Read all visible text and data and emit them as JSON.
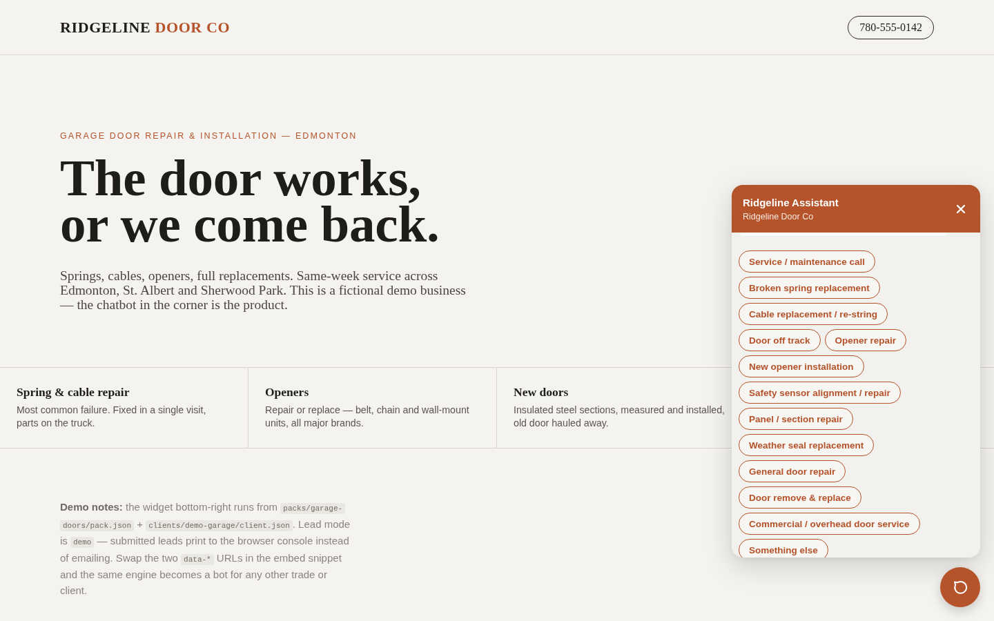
{
  "header": {
    "brand": {
      "name": "RIDGELINE",
      "accent": "DOOR CO"
    },
    "phone": "780-555-0142"
  },
  "hero": {
    "eyebrow": "GARAGE DOOR REPAIR & INSTALLATION — EDMONTON",
    "headline": [
      "The door works,",
      "or we come back."
    ],
    "lede": "Springs, cables, openers, full replacements. Same-week service across Edmonton, St. Albert and Sherwood Park. This is a fictional demo business — the chatbot in the corner is the product."
  },
  "services": [
    {
      "title": "Spring & cable repair",
      "description": "Most common failure. Fixed in a single visit, parts on the truck."
    },
    {
      "title": "Openers",
      "description": "Repair or replace — belt, chain and wall-mount units, all major brands."
    },
    {
      "title": "New doors",
      "description": "Insulated steel sections, measured and installed, old door hauled away."
    }
  ],
  "demo_notes": [
    {
      "kind": "text",
      "text": "**Demo notes:** the widget bottom-right runs from "
    },
    {
      "kind": "code",
      "text": "packs/garage-doors/pack.json"
    },
    {
      "kind": "text",
      "text": " + "
    },
    {
      "kind": "code",
      "text": "clients/demo-garage/client.json"
    },
    {
      "kind": "text",
      "text": ". Lead mode is "
    },
    {
      "kind": "code",
      "text": "demo"
    },
    {
      "kind": "text",
      "text": " — submitted leads print to the browser console instead of emailing. Swap the two "
    },
    {
      "kind": "code",
      "text": "data-*"
    },
    {
      "kind": "text",
      "text": " URLs in the embed snippet and the same engine becomes a bot for any other trade or client."
    }
  ],
  "chat": {
    "title": "Ridgeline Assistant",
    "subtitle": "Ridgeline Door Co",
    "options": [
      "Service / maintenance call",
      "Broken spring replacement",
      "Cable replacement / re-string",
      "Door off track",
      "Opener repair",
      "New opener installation",
      "Safety sensor alignment / repair",
      "Panel / section repair",
      "Weather seal replacement",
      "General door repair",
      "Door remove & replace",
      "Commercial / overhead door service",
      "Something else"
    ]
  }
}
